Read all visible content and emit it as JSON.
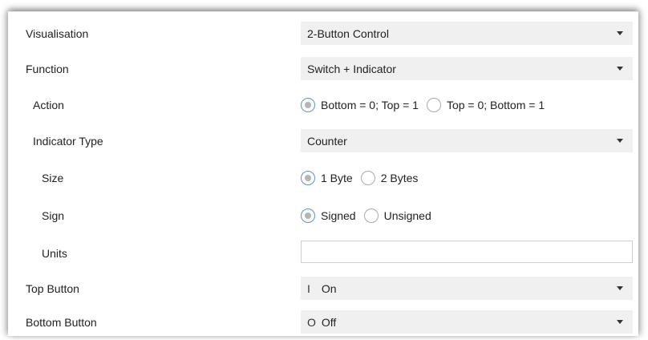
{
  "fields": {
    "visualisation": {
      "label": "Visualisation",
      "value": "2-Button Control"
    },
    "function": {
      "label": "Function",
      "value": "Switch + Indicator"
    },
    "action": {
      "label": "Action",
      "options": [
        "Bottom = 0; Top = 1",
        "Top = 0; Bottom = 1"
      ],
      "selected": "Bottom = 0; Top = 1"
    },
    "indicator_type": {
      "label": "Indicator Type",
      "value": "Counter"
    },
    "size": {
      "label": "Size",
      "options": [
        "1 Byte",
        "2 Bytes"
      ],
      "selected": "1 Byte"
    },
    "sign": {
      "label": "Sign",
      "options": [
        "Signed",
        "Unsigned"
      ],
      "selected": "Signed"
    },
    "units": {
      "label": "Units",
      "value": ""
    },
    "top_button": {
      "label": "Top Button",
      "symbol": "I",
      "value": "On"
    },
    "bottom_button": {
      "label": "Bottom Button",
      "symbol": "O",
      "value": "Off"
    }
  },
  "icons": {
    "dropdown": "chevron-down-icon",
    "radio": "radio-icon"
  },
  "colors": {
    "select_bg": "#f0f0f0",
    "radio_checked_border": "#5a8fd6"
  }
}
